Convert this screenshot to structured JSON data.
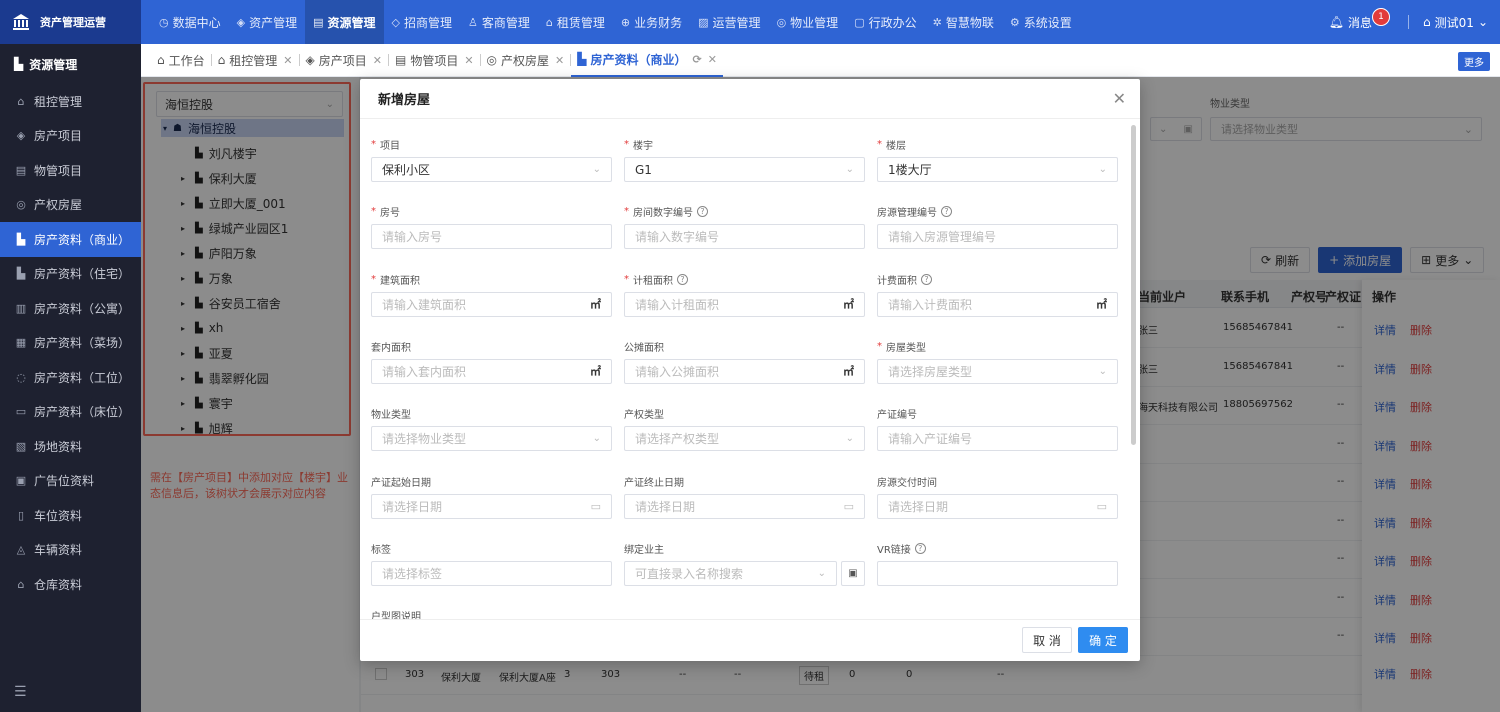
{
  "brand": {
    "name": "资产管理运营"
  },
  "topnav": [
    {
      "icon": "◷",
      "label": "数据中心",
      "active": false
    },
    {
      "icon": "◈",
      "label": "资产管理",
      "active": false
    },
    {
      "icon": "▤",
      "label": "资源管理",
      "active": true
    },
    {
      "icon": "◇",
      "label": "招商管理",
      "active": false
    },
    {
      "icon": "♙",
      "label": "客商管理",
      "active": false
    },
    {
      "icon": "⌂",
      "label": "租赁管理",
      "active": false
    },
    {
      "icon": "⊕",
      "label": "业务财务",
      "active": false
    },
    {
      "icon": "▨",
      "label": "运营管理",
      "active": false
    },
    {
      "icon": "◎",
      "label": "物业管理",
      "active": false
    },
    {
      "icon": "▢",
      "label": "行政办公",
      "active": false
    },
    {
      "icon": "✲",
      "label": "智慧物联",
      "active": false
    },
    {
      "icon": "⚙",
      "label": "系统设置",
      "active": false
    }
  ],
  "topright": {
    "messages": "消息",
    "badge": "1",
    "user": "测试01"
  },
  "sidebar": {
    "title": "资源管理",
    "items": [
      {
        "icon": "⌂",
        "label": "租控管理",
        "active": false
      },
      {
        "icon": "◈",
        "label": "房产项目",
        "active": false
      },
      {
        "icon": "▤",
        "label": "物管项目",
        "active": false
      },
      {
        "icon": "◎",
        "label": "产权房屋",
        "active": false
      },
      {
        "icon": "▙",
        "label": "房产资料（商业）",
        "active": true
      },
      {
        "icon": "▙",
        "label": "房产资料（住宅）",
        "active": false
      },
      {
        "icon": "▥",
        "label": "房产资料（公寓）",
        "active": false
      },
      {
        "icon": "▦",
        "label": "房产资料（菜场）",
        "active": false
      },
      {
        "icon": "◌",
        "label": "房产资料（工位）",
        "active": false
      },
      {
        "icon": "▭",
        "label": "房产资料（床位）",
        "active": false
      },
      {
        "icon": "▧",
        "label": "场地资料",
        "active": false
      },
      {
        "icon": "▣",
        "label": "广告位资料",
        "active": false
      },
      {
        "icon": "▯",
        "label": "车位资料",
        "active": false
      },
      {
        "icon": "◬",
        "label": "车辆资料",
        "active": false
      },
      {
        "icon": "⌂",
        "label": "仓库资料",
        "active": false
      }
    ]
  },
  "tabs": [
    {
      "icon": "⌂",
      "label": "工作台",
      "closable": false,
      "active": false
    },
    {
      "icon": "⌂",
      "label": "租控管理",
      "closable": true,
      "active": false
    },
    {
      "icon": "◈",
      "label": "房产项目",
      "closable": true,
      "active": false
    },
    {
      "icon": "▤",
      "label": "物管项目",
      "closable": true,
      "active": false
    },
    {
      "icon": "◎",
      "label": "产权房屋",
      "closable": true,
      "active": false
    },
    {
      "icon": "▙",
      "label": "房产资料（商业）",
      "closable": true,
      "active": true
    }
  ],
  "tab_more": "更多",
  "tree": {
    "select_value": "海恒控股",
    "root": "海恒控股",
    "items": [
      {
        "label": "刘凡楼宇",
        "expandable": false
      },
      {
        "label": "保利大厦",
        "expandable": true
      },
      {
        "label": "立即大厦_001",
        "expandable": true
      },
      {
        "label": "绿城产业园区1",
        "expandable": true
      },
      {
        "label": "庐阳万象",
        "expandable": true
      },
      {
        "label": "万象",
        "expandable": true
      },
      {
        "label": "谷安员工宿舍",
        "expandable": true
      },
      {
        "label": "xh",
        "expandable": true
      },
      {
        "label": "亚夏",
        "expandable": true
      },
      {
        "label": "翡翠孵化园",
        "expandable": true
      },
      {
        "label": "寰宇",
        "expandable": true
      },
      {
        "label": "旭辉",
        "expandable": true
      }
    ],
    "note": "需在【房产项目】中添加对应【楼宇】业态信息后，该树状才会展示对应内容"
  },
  "filters": {
    "property_type_label": "物业类型",
    "property_type_placeholder": "请选择物业类型"
  },
  "toolbar": {
    "refresh": "刷新",
    "add": "添加房屋",
    "more": "更多"
  },
  "table": {
    "headers": [
      "当前业户",
      "联系手机",
      "产权号",
      "产权证",
      "操作"
    ],
    "rows": [
      {
        "tenant": "张三",
        "phone": "15685467841",
        "deed": "--"
      },
      {
        "tenant": "张三",
        "phone": "15685467841",
        "deed": "--"
      },
      {
        "tenant": "海天科技有限公司",
        "phone": "18805697562",
        "deed": "--"
      },
      {
        "tenant": "",
        "phone": "",
        "deed": "--"
      },
      {
        "tenant": "",
        "phone": "",
        "deed": "--"
      },
      {
        "tenant": "",
        "phone": "",
        "deed": "--"
      },
      {
        "tenant": "",
        "phone": "",
        "deed": "--"
      },
      {
        "tenant": "",
        "phone": "",
        "deed": "--"
      },
      {
        "tenant": "",
        "phone": "",
        "deed": "--"
      }
    ],
    "detail": "详情",
    "delete": "删除",
    "last_row": {
      "c1": "303",
      "c2": "保利大厦",
      "c3": "保利大厦A座",
      "c4": "3",
      "c5": "303",
      "c6": "--",
      "c7": "--",
      "status": "待租",
      "c9": "0",
      "c10": "0",
      "c11": "--"
    }
  },
  "modal": {
    "title": "新增房屋",
    "fields": {
      "project": {
        "label": "项目",
        "value": "保利小区"
      },
      "building": {
        "label": "楼宇",
        "value": "G1"
      },
      "floor": {
        "label": "楼层",
        "value": "1楼大厅"
      },
      "room_no": {
        "label": "房号",
        "placeholder": "请输入房号"
      },
      "room_num_code": {
        "label": "房间数字编号",
        "placeholder": "请输入数字编号"
      },
      "room_mgmt_code": {
        "label": "房源管理编号",
        "placeholder": "请输入房源管理编号"
      },
      "build_area": {
        "label": "建筑面积",
        "placeholder": "请输入建筑面积",
        "unit": "㎡"
      },
      "rent_area": {
        "label": "计租面积",
        "placeholder": "请输入计租面积",
        "unit": "㎡"
      },
      "charge_area": {
        "label": "计费面积",
        "placeholder": "请输入计费面积",
        "unit": "㎡"
      },
      "inner_area": {
        "label": "套内面积",
        "placeholder": "请输入套内面积",
        "unit": "㎡"
      },
      "shared_area": {
        "label": "公摊面积",
        "placeholder": "请输入公摊面积",
        "unit": "㎡"
      },
      "room_type": {
        "label": "房屋类型",
        "placeholder": "请选择房屋类型"
      },
      "property_type": {
        "label": "物业类型",
        "placeholder": "请选择物业类型"
      },
      "deed_type": {
        "label": "产权类型",
        "placeholder": "请选择产权类型"
      },
      "deed_no": {
        "label": "产证编号",
        "placeholder": "请输入产证编号"
      },
      "deed_start": {
        "label": "产证起始日期",
        "placeholder": "请选择日期"
      },
      "deed_end": {
        "label": "产证终止日期",
        "placeholder": "请选择日期"
      },
      "delivery": {
        "label": "房源交付时间",
        "placeholder": "请选择日期"
      },
      "tags": {
        "label": "标签",
        "placeholder": "请选择标签"
      },
      "owner": {
        "label": "绑定业主",
        "placeholder": "可直接录入名称搜索"
      },
      "vr": {
        "label": "VR链接",
        "placeholder": ""
      },
      "layout_desc": {
        "label": "户型图说明"
      }
    },
    "cancel": "取 消",
    "confirm": "确 定"
  }
}
